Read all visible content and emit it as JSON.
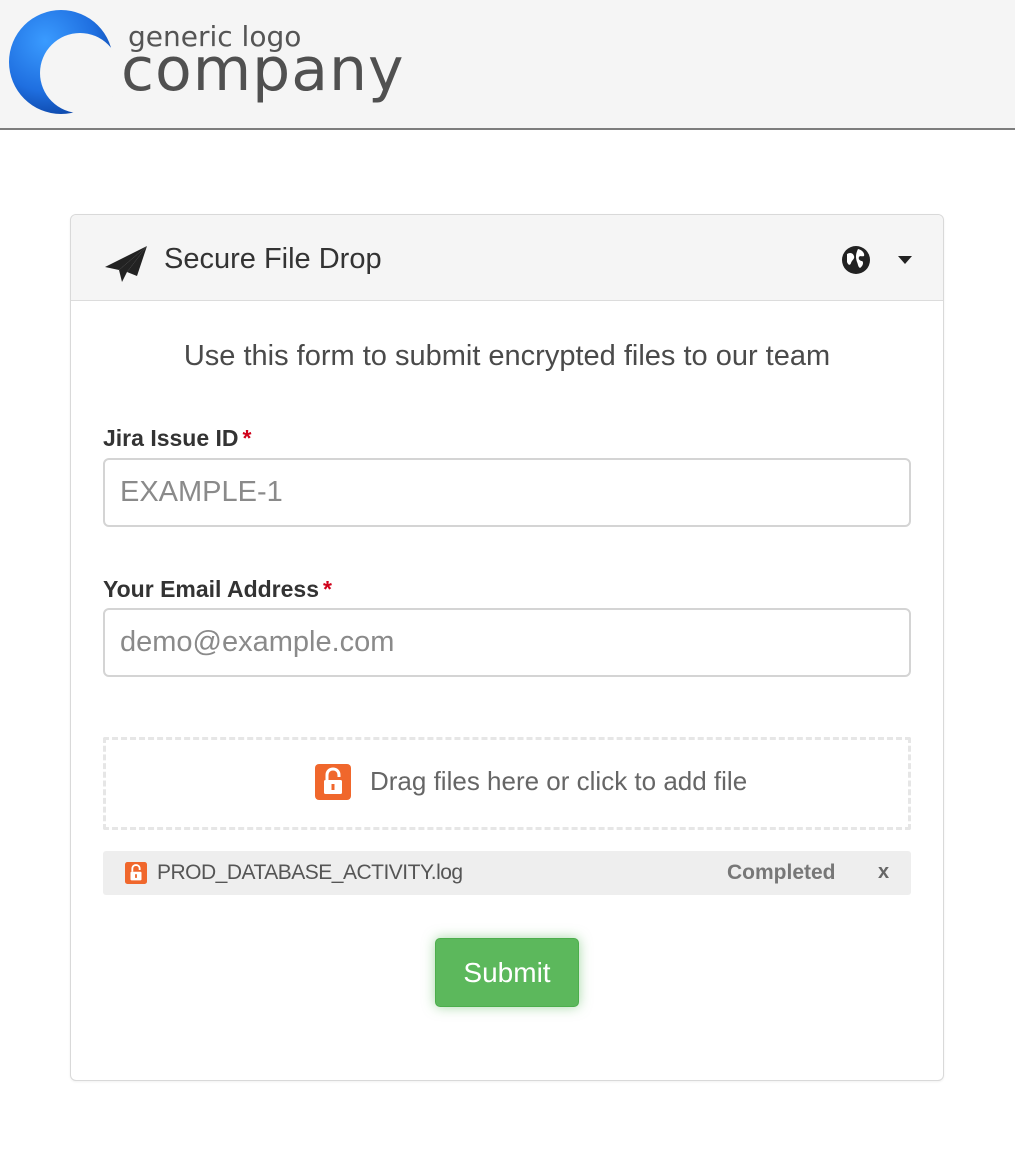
{
  "header": {
    "logo_small": "generic logo",
    "logo_big": "company",
    "logo_colors": {
      "primary": "#1f7ae0",
      "dark": "#0a3f9e"
    }
  },
  "panel": {
    "title": "Secure File Drop",
    "title_icon": "paper-plane-icon",
    "language_icon": "globe-icon",
    "intro": "Use this form to submit encrypted files to our team"
  },
  "form": {
    "jira": {
      "label": "Jira Issue ID",
      "required_mark": "*",
      "placeholder": "EXAMPLE-1",
      "value": ""
    },
    "email": {
      "label": "Your Email Address",
      "required_mark": "*",
      "placeholder": "demo@example.com",
      "value": ""
    },
    "dropzone": {
      "icon": "lock-icon",
      "text": "Drag files here or click to add file"
    },
    "files": [
      {
        "name": "PROD_DATABASE_ACTIVITY.log",
        "status": "Completed",
        "remove": "x",
        "icon": "lock-icon"
      }
    ],
    "submit_label": "Submit"
  },
  "colors": {
    "accent_green": "#5cb85c",
    "required_red": "#d0021b",
    "lock_orange": "#f0672c"
  }
}
